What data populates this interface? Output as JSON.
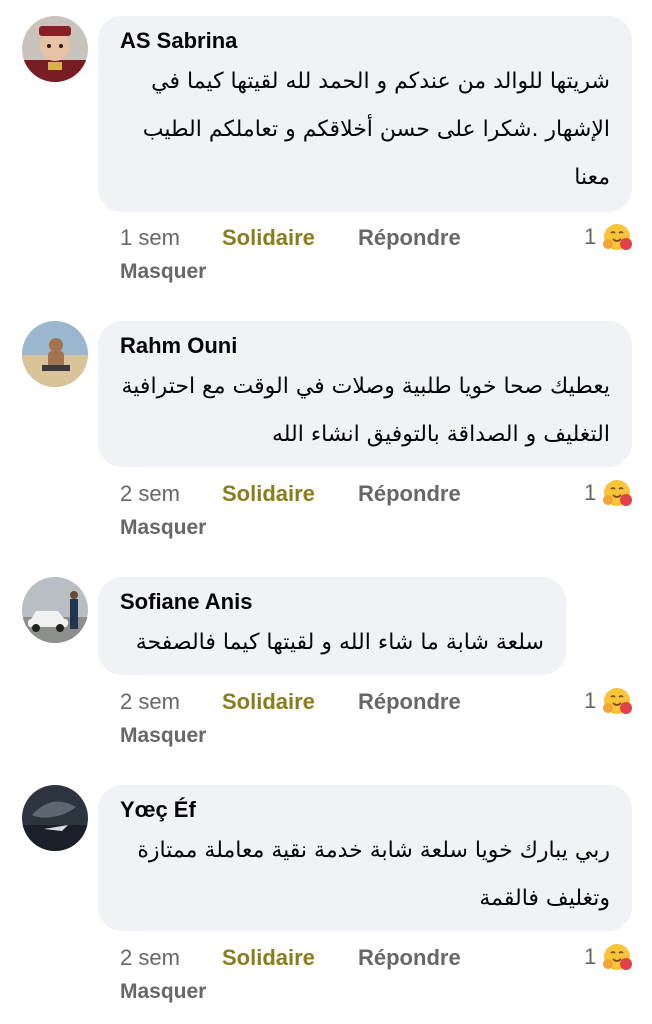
{
  "actions": {
    "support_label": "Solidaire",
    "reply_label": "Répondre",
    "hide_label": "Masquer"
  },
  "colors": {
    "bubble": "#f0f2f5",
    "support": "#8a7d1c",
    "meta_text": "#65676b"
  },
  "comments": [
    {
      "author": "AS Sabrina",
      "text": "شريتها للوالد من عندكم و الحمد لله لقيتها كيما في الإشهار .شكرا على حسن أخلاقكم و تعاملكم الطيب معنا",
      "time": "1 sem",
      "reaction_count": "1",
      "reaction_icon": "hug-emoji-icon"
    },
    {
      "author": "Rahm Ouni",
      "text": "يعطيك صحا خويا طلبية وصلات في الوقت مع احترافية التغليف و الصداقة بالتوفيق انشاء الله",
      "time": "2 sem",
      "reaction_count": "1",
      "reaction_icon": "hug-emoji-icon"
    },
    {
      "author": "Sofiane Anis",
      "text": "سلعة شابة ما شاء الله و لقيتها كيما فالصفحة",
      "time": "2 sem",
      "reaction_count": "1",
      "reaction_icon": "hug-emoji-icon"
    },
    {
      "author": "Yœç Éf",
      "text": "ربي يبارك خويا سلعة شابة خدمة نقية معاملة ممتازة وتغليف فالقمة",
      "time": "2 sem",
      "reaction_count": "1",
      "reaction_icon": "hug-emoji-icon"
    }
  ]
}
